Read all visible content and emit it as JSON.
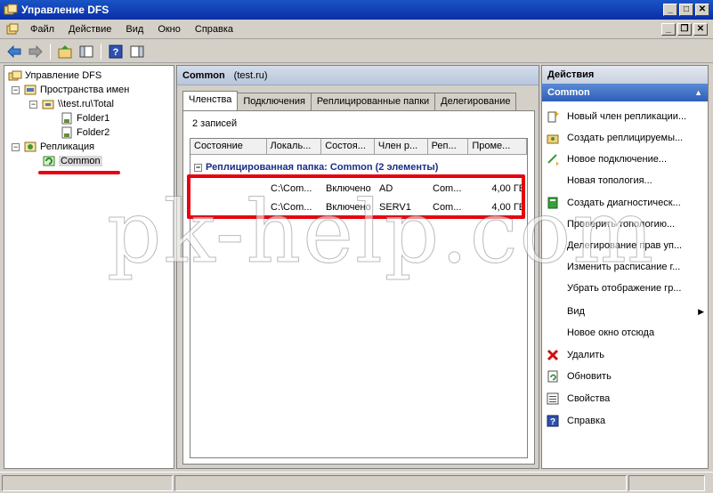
{
  "window": {
    "title": "Управление DFS"
  },
  "menu": [
    "Файл",
    "Действие",
    "Вид",
    "Окно",
    "Справка"
  ],
  "tree": {
    "root": "Управление DFS",
    "namespaces": "Пространства имен",
    "namespace_path": "\\\\test.ru\\Total",
    "folders": [
      "Folder1",
      "Folder2"
    ],
    "replication": "Репликация",
    "group": "Common"
  },
  "center": {
    "title": "Common",
    "domain": "(test.ru)",
    "tabs": [
      "Членства",
      "Подключения",
      "Реплицированные папки",
      "Делегирование"
    ],
    "record_count": "2 записей",
    "columns": [
      "Состояние",
      "Локаль...",
      "Состоя...",
      "Член р...",
      "Реп...",
      "Проме..."
    ],
    "group_label": "Реплицированная папка: Common (2 элементы)",
    "rows": [
      {
        "state": "",
        "local": "C:\\Com...",
        "status": "Включено",
        "member": "AD",
        "rep": "Com...",
        "staging": "4,00 ГБ"
      },
      {
        "state": "",
        "local": "C:\\Com...",
        "status": "Включено",
        "member": "SERV1",
        "rep": "Com...",
        "staging": "4,00 ГБ"
      }
    ]
  },
  "actions": {
    "header": "Действия",
    "subheader": "Common",
    "items": [
      "Новый член репликации...",
      "Создать реплицируемы...",
      "Новое подключение...",
      "Новая топология...",
      "Создать диагностическ...",
      "Проверить топологию...",
      "Делегирование прав уп...",
      "Изменить расписание г...",
      "Убрать отображение гр...",
      "Вид",
      "Новое окно отсюда",
      "Удалить",
      "Обновить",
      "Свойства",
      "Справка"
    ]
  },
  "watermark": "pk-help.com",
  "colors": {
    "highlight": "#e8000d",
    "titlebar": "#0a2fa8"
  }
}
